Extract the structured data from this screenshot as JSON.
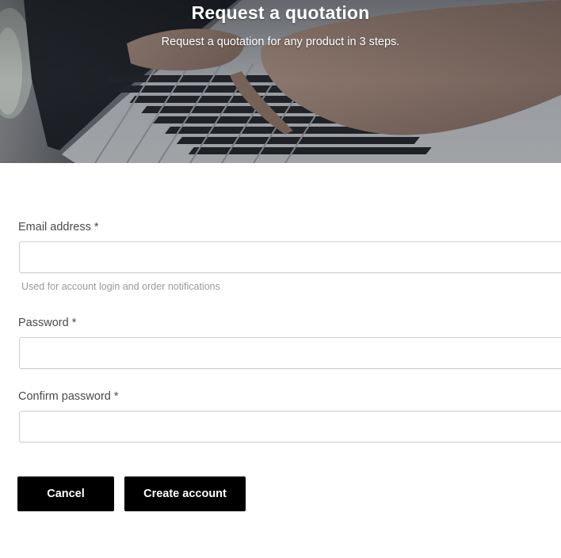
{
  "hero": {
    "title": "Request a quotation",
    "subtitle": "Request a quotation for any product in 3 steps.",
    "background_image": "laptop-typing-photo"
  },
  "form": {
    "email": {
      "label": "Email address *",
      "value": "",
      "placeholder": "",
      "help": "Used for account login and order notifications"
    },
    "password": {
      "label": "Password *",
      "value": "",
      "placeholder": ""
    },
    "confirm_password": {
      "label": "Confirm password *",
      "value": "",
      "placeholder": ""
    }
  },
  "actions": {
    "cancel_label": "Cancel",
    "create_label": "Create account"
  },
  "colors": {
    "button_bg": "#000000",
    "button_text": "#ffffff",
    "label_text": "#4a4a4a",
    "help_text": "#9a9a9a"
  }
}
